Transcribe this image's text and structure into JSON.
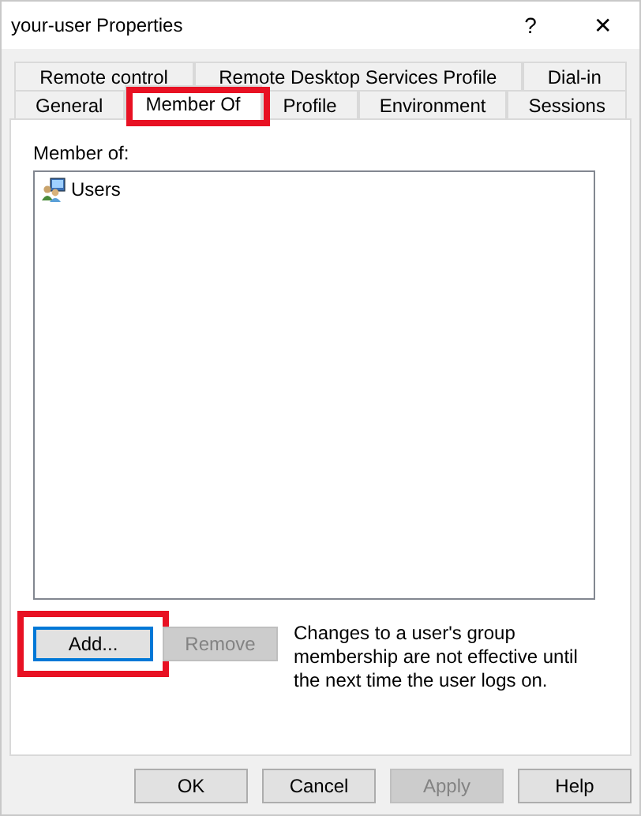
{
  "window": {
    "title": "your-user Properties",
    "help_glyph": "?",
    "close_glyph": "✕"
  },
  "tab_rows": [
    [
      {
        "label": "Remote control",
        "selected": false,
        "highlighted": false
      },
      {
        "label": "Remote Desktop Services Profile",
        "selected": false,
        "highlighted": false
      },
      {
        "label": "Dial-in",
        "selected": false,
        "highlighted": false
      }
    ],
    [
      {
        "label": "General",
        "selected": false,
        "highlighted": false
      },
      {
        "label": "Member Of",
        "selected": true,
        "highlighted": true
      },
      {
        "label": "Profile",
        "selected": false,
        "highlighted": false
      },
      {
        "label": "Environment",
        "selected": false,
        "highlighted": false
      },
      {
        "label": "Sessions",
        "selected": false,
        "highlighted": false
      }
    ]
  ],
  "member_of": {
    "label": "Member of:",
    "items": [
      {
        "name": "Users",
        "selected": false
      }
    ]
  },
  "actions": [
    {
      "label": "Add...",
      "disabled": false,
      "focused": true,
      "highlighted": true
    },
    {
      "label": "Remove",
      "disabled": true,
      "focused": false,
      "highlighted": false
    }
  ],
  "note": "Changes to a user's group membership are not effective until the next time the user logs on.",
  "buttons": [
    {
      "label": "OK",
      "disabled": false
    },
    {
      "label": "Cancel",
      "disabled": false
    },
    {
      "label": "Apply",
      "disabled": true
    },
    {
      "label": "Help",
      "disabled": false
    }
  ]
}
